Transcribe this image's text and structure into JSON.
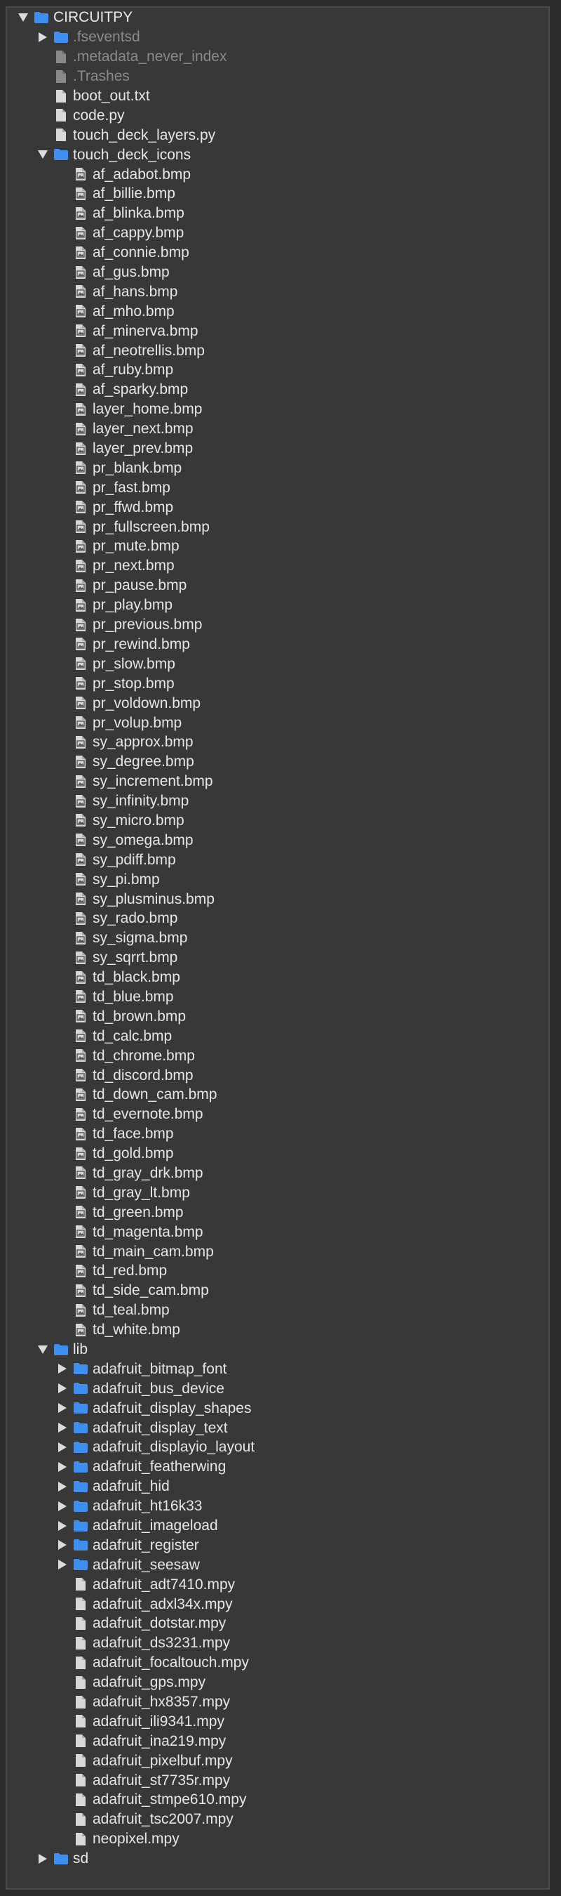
{
  "colors": {
    "background": "#2b2b2b",
    "panel": "#383838",
    "folder": "#3d8ff2",
    "text": "#e6e6e6",
    "dim_text": "#8a8a8a"
  },
  "tree": [
    {
      "label": "CIRCUITPY",
      "depth": 0,
      "kind": "folder",
      "expanded": true,
      "dim": false
    },
    {
      "label": ".fseventsd",
      "depth": 1,
      "kind": "folder",
      "expanded": false,
      "dim": true
    },
    {
      "label": ".metadata_never_index",
      "depth": 1,
      "kind": "file",
      "dim": true
    },
    {
      "label": ".Trashes",
      "depth": 1,
      "kind": "file",
      "dim": true
    },
    {
      "label": "boot_out.txt",
      "depth": 1,
      "kind": "file",
      "dim": false
    },
    {
      "label": "code.py",
      "depth": 1,
      "kind": "file",
      "dim": false
    },
    {
      "label": "touch_deck_layers.py",
      "depth": 1,
      "kind": "file",
      "dim": false
    },
    {
      "label": "touch_deck_icons",
      "depth": 1,
      "kind": "folder",
      "expanded": true,
      "dim": false
    },
    {
      "label": "af_adabot.bmp",
      "depth": 2,
      "kind": "image",
      "dim": false
    },
    {
      "label": "af_billie.bmp",
      "depth": 2,
      "kind": "image",
      "dim": false
    },
    {
      "label": "af_blinka.bmp",
      "depth": 2,
      "kind": "image",
      "dim": false
    },
    {
      "label": "af_cappy.bmp",
      "depth": 2,
      "kind": "image",
      "dim": false
    },
    {
      "label": "af_connie.bmp",
      "depth": 2,
      "kind": "image",
      "dim": false
    },
    {
      "label": "af_gus.bmp",
      "depth": 2,
      "kind": "image",
      "dim": false
    },
    {
      "label": "af_hans.bmp",
      "depth": 2,
      "kind": "image",
      "dim": false
    },
    {
      "label": "af_mho.bmp",
      "depth": 2,
      "kind": "image",
      "dim": false
    },
    {
      "label": "af_minerva.bmp",
      "depth": 2,
      "kind": "image",
      "dim": false
    },
    {
      "label": "af_neotrellis.bmp",
      "depth": 2,
      "kind": "image",
      "dim": false
    },
    {
      "label": "af_ruby.bmp",
      "depth": 2,
      "kind": "image",
      "dim": false
    },
    {
      "label": "af_sparky.bmp",
      "depth": 2,
      "kind": "image",
      "dim": false
    },
    {
      "label": "layer_home.bmp",
      "depth": 2,
      "kind": "image",
      "dim": false
    },
    {
      "label": "layer_next.bmp",
      "depth": 2,
      "kind": "image",
      "dim": false
    },
    {
      "label": "layer_prev.bmp",
      "depth": 2,
      "kind": "image",
      "dim": false
    },
    {
      "label": "pr_blank.bmp",
      "depth": 2,
      "kind": "image",
      "dim": false
    },
    {
      "label": "pr_fast.bmp",
      "depth": 2,
      "kind": "image",
      "dim": false
    },
    {
      "label": "pr_ffwd.bmp",
      "depth": 2,
      "kind": "image",
      "dim": false
    },
    {
      "label": "pr_fullscreen.bmp",
      "depth": 2,
      "kind": "image",
      "dim": false
    },
    {
      "label": "pr_mute.bmp",
      "depth": 2,
      "kind": "image",
      "dim": false
    },
    {
      "label": "pr_next.bmp",
      "depth": 2,
      "kind": "image",
      "dim": false
    },
    {
      "label": "pr_pause.bmp",
      "depth": 2,
      "kind": "image",
      "dim": false
    },
    {
      "label": "pr_play.bmp",
      "depth": 2,
      "kind": "image",
      "dim": false
    },
    {
      "label": "pr_previous.bmp",
      "depth": 2,
      "kind": "image",
      "dim": false
    },
    {
      "label": "pr_rewind.bmp",
      "depth": 2,
      "kind": "image",
      "dim": false
    },
    {
      "label": "pr_slow.bmp",
      "depth": 2,
      "kind": "image",
      "dim": false
    },
    {
      "label": "pr_stop.bmp",
      "depth": 2,
      "kind": "image",
      "dim": false
    },
    {
      "label": "pr_voldown.bmp",
      "depth": 2,
      "kind": "image",
      "dim": false
    },
    {
      "label": "pr_volup.bmp",
      "depth": 2,
      "kind": "image",
      "dim": false
    },
    {
      "label": "sy_approx.bmp",
      "depth": 2,
      "kind": "image",
      "dim": false
    },
    {
      "label": "sy_degree.bmp",
      "depth": 2,
      "kind": "image",
      "dim": false
    },
    {
      "label": "sy_increment.bmp",
      "depth": 2,
      "kind": "image",
      "dim": false
    },
    {
      "label": "sy_infinity.bmp",
      "depth": 2,
      "kind": "image",
      "dim": false
    },
    {
      "label": "sy_micro.bmp",
      "depth": 2,
      "kind": "image",
      "dim": false
    },
    {
      "label": "sy_omega.bmp",
      "depth": 2,
      "kind": "image",
      "dim": false
    },
    {
      "label": "sy_pdiff.bmp",
      "depth": 2,
      "kind": "image",
      "dim": false
    },
    {
      "label": "sy_pi.bmp",
      "depth": 2,
      "kind": "image",
      "dim": false
    },
    {
      "label": "sy_plusminus.bmp",
      "depth": 2,
      "kind": "image",
      "dim": false
    },
    {
      "label": "sy_rado.bmp",
      "depth": 2,
      "kind": "image",
      "dim": false
    },
    {
      "label": "sy_sigma.bmp",
      "depth": 2,
      "kind": "image",
      "dim": false
    },
    {
      "label": "sy_sqrrt.bmp",
      "depth": 2,
      "kind": "image",
      "dim": false
    },
    {
      "label": "td_black.bmp",
      "depth": 2,
      "kind": "image",
      "dim": false
    },
    {
      "label": "td_blue.bmp",
      "depth": 2,
      "kind": "image",
      "dim": false
    },
    {
      "label": "td_brown.bmp",
      "depth": 2,
      "kind": "image",
      "dim": false
    },
    {
      "label": "td_calc.bmp",
      "depth": 2,
      "kind": "image",
      "dim": false
    },
    {
      "label": "td_chrome.bmp",
      "depth": 2,
      "kind": "image",
      "dim": false
    },
    {
      "label": "td_discord.bmp",
      "depth": 2,
      "kind": "image",
      "dim": false
    },
    {
      "label": "td_down_cam.bmp",
      "depth": 2,
      "kind": "image",
      "dim": false
    },
    {
      "label": "td_evernote.bmp",
      "depth": 2,
      "kind": "image",
      "dim": false
    },
    {
      "label": "td_face.bmp",
      "depth": 2,
      "kind": "image",
      "dim": false
    },
    {
      "label": "td_gold.bmp",
      "depth": 2,
      "kind": "image",
      "dim": false
    },
    {
      "label": "td_gray_drk.bmp",
      "depth": 2,
      "kind": "image",
      "dim": false
    },
    {
      "label": "td_gray_lt.bmp",
      "depth": 2,
      "kind": "image",
      "dim": false
    },
    {
      "label": "td_green.bmp",
      "depth": 2,
      "kind": "image",
      "dim": false
    },
    {
      "label": "td_magenta.bmp",
      "depth": 2,
      "kind": "image",
      "dim": false
    },
    {
      "label": "td_main_cam.bmp",
      "depth": 2,
      "kind": "image",
      "dim": false
    },
    {
      "label": "td_red.bmp",
      "depth": 2,
      "kind": "image",
      "dim": false
    },
    {
      "label": "td_side_cam.bmp",
      "depth": 2,
      "kind": "image",
      "dim": false
    },
    {
      "label": "td_teal.bmp",
      "depth": 2,
      "kind": "image",
      "dim": false
    },
    {
      "label": "td_white.bmp",
      "depth": 2,
      "kind": "image",
      "dim": false
    },
    {
      "label": "lib",
      "depth": 1,
      "kind": "folder",
      "expanded": true,
      "dim": false
    },
    {
      "label": "adafruit_bitmap_font",
      "depth": 2,
      "kind": "folder",
      "expanded": false,
      "dim": false
    },
    {
      "label": "adafruit_bus_device",
      "depth": 2,
      "kind": "folder",
      "expanded": false,
      "dim": false
    },
    {
      "label": "adafruit_display_shapes",
      "depth": 2,
      "kind": "folder",
      "expanded": false,
      "dim": false
    },
    {
      "label": "adafruit_display_text",
      "depth": 2,
      "kind": "folder",
      "expanded": false,
      "dim": false
    },
    {
      "label": "adafruit_displayio_layout",
      "depth": 2,
      "kind": "folder",
      "expanded": false,
      "dim": false
    },
    {
      "label": "adafruit_featherwing",
      "depth": 2,
      "kind": "folder",
      "expanded": false,
      "dim": false
    },
    {
      "label": "adafruit_hid",
      "depth": 2,
      "kind": "folder",
      "expanded": false,
      "dim": false
    },
    {
      "label": "adafruit_ht16k33",
      "depth": 2,
      "kind": "folder",
      "expanded": false,
      "dim": false
    },
    {
      "label": "adafruit_imageload",
      "depth": 2,
      "kind": "folder",
      "expanded": false,
      "dim": false
    },
    {
      "label": "adafruit_register",
      "depth": 2,
      "kind": "folder",
      "expanded": false,
      "dim": false
    },
    {
      "label": "adafruit_seesaw",
      "depth": 2,
      "kind": "folder",
      "expanded": false,
      "dim": false
    },
    {
      "label": "adafruit_adt7410.mpy",
      "depth": 2,
      "kind": "file",
      "dim": false
    },
    {
      "label": "adafruit_adxl34x.mpy",
      "depth": 2,
      "kind": "file",
      "dim": false
    },
    {
      "label": "adafruit_dotstar.mpy",
      "depth": 2,
      "kind": "file",
      "dim": false
    },
    {
      "label": "adafruit_ds3231.mpy",
      "depth": 2,
      "kind": "file",
      "dim": false
    },
    {
      "label": "adafruit_focaltouch.mpy",
      "depth": 2,
      "kind": "file",
      "dim": false
    },
    {
      "label": "adafruit_gps.mpy",
      "depth": 2,
      "kind": "file",
      "dim": false
    },
    {
      "label": "adafruit_hx8357.mpy",
      "depth": 2,
      "kind": "file",
      "dim": false
    },
    {
      "label": "adafruit_ili9341.mpy",
      "depth": 2,
      "kind": "file",
      "dim": false
    },
    {
      "label": "adafruit_ina219.mpy",
      "depth": 2,
      "kind": "file",
      "dim": false
    },
    {
      "label": "adafruit_pixelbuf.mpy",
      "depth": 2,
      "kind": "file",
      "dim": false
    },
    {
      "label": "adafruit_st7735r.mpy",
      "depth": 2,
      "kind": "file",
      "dim": false
    },
    {
      "label": "adafruit_stmpe610.mpy",
      "depth": 2,
      "kind": "file",
      "dim": false
    },
    {
      "label": "adafruit_tsc2007.mpy",
      "depth": 2,
      "kind": "file",
      "dim": false
    },
    {
      "label": "neopixel.mpy",
      "depth": 2,
      "kind": "file",
      "dim": false
    },
    {
      "label": "sd",
      "depth": 1,
      "kind": "folder",
      "expanded": false,
      "dim": false
    }
  ]
}
